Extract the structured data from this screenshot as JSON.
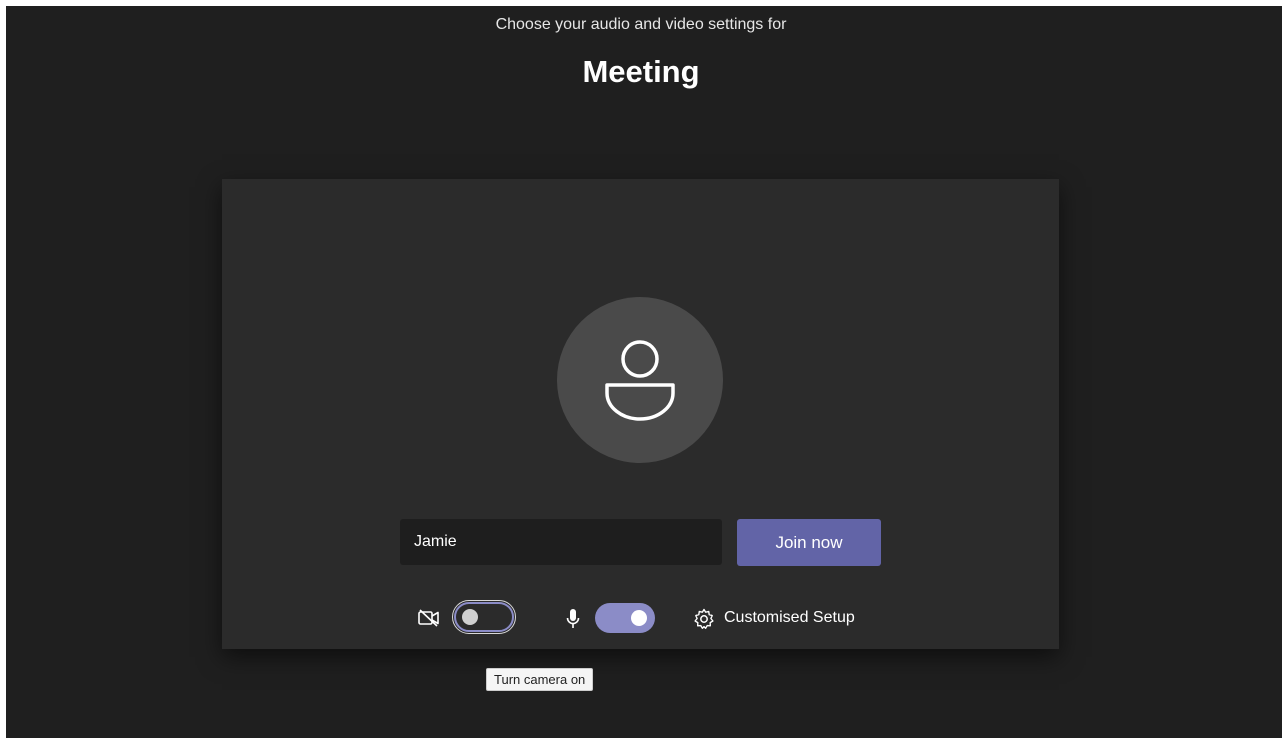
{
  "header": {
    "subtitle": "Choose your audio and video settings for",
    "title": "Meeting"
  },
  "prejoin": {
    "name_value": "Jamie",
    "join_label": "Join now",
    "camera_on": false,
    "mic_on": true,
    "custom_setup_label": "Customised Setup",
    "tooltip": "Turn camera on"
  },
  "icons": {
    "avatar": "person-icon",
    "camera": "camera-off-icon",
    "mic": "microphone-icon",
    "settings": "gear-icon"
  },
  "colors": {
    "background": "#1f1f1f",
    "panel": "#2b2b2b",
    "accent": "#6264a7",
    "toggle_accent": "#8b8cc7"
  }
}
